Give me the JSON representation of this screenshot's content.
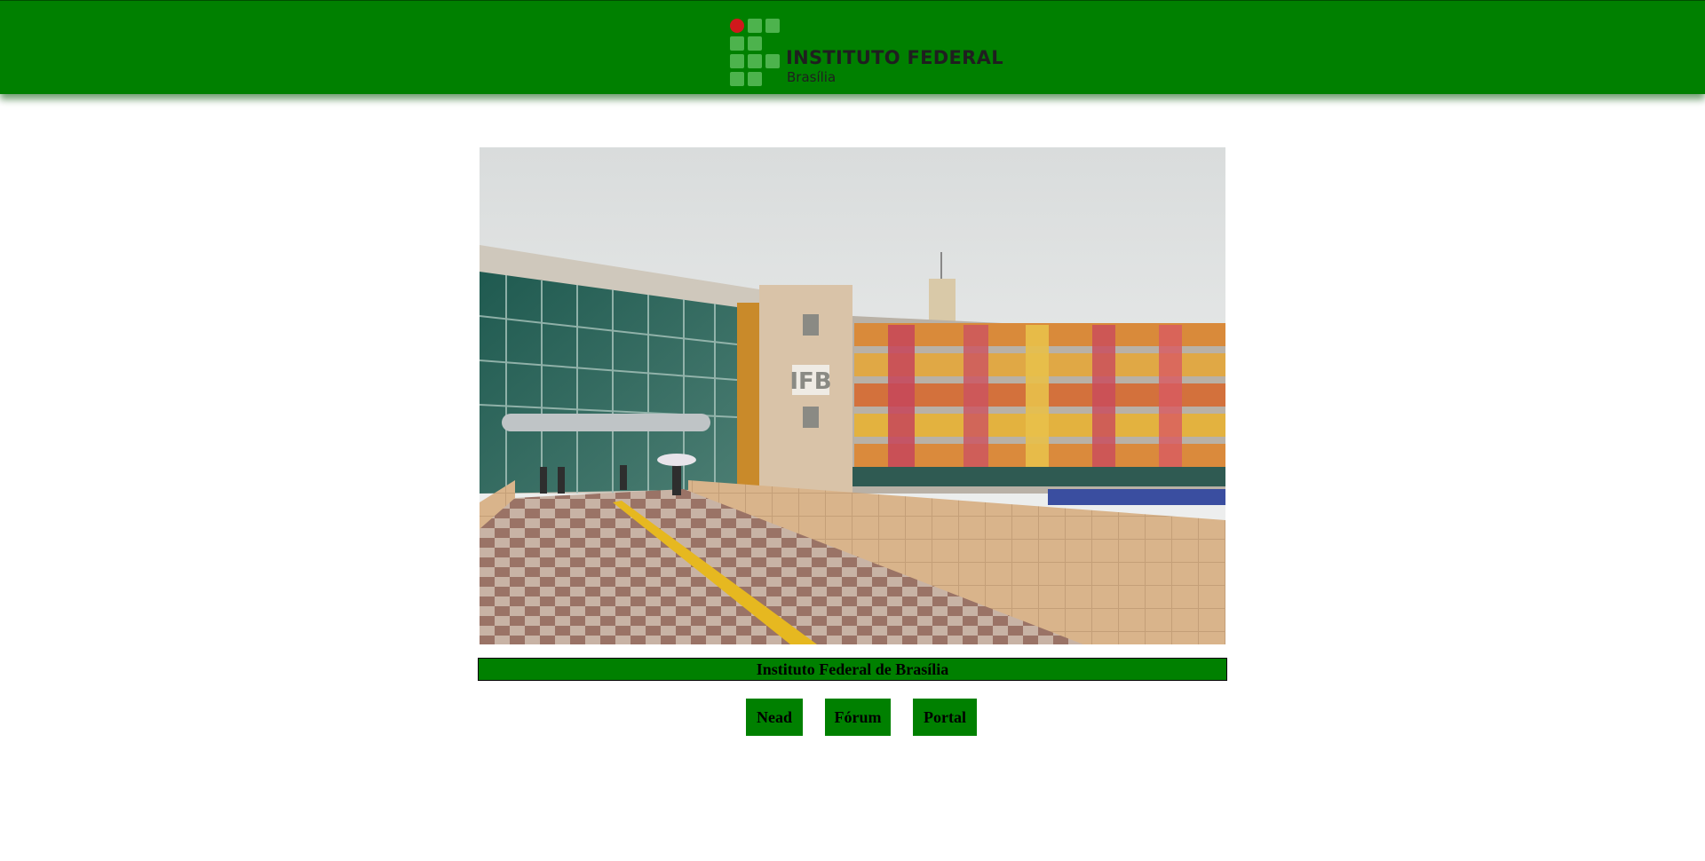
{
  "header": {
    "logo_title": "INSTITUTO FEDERAL",
    "logo_subtitle": "Brasília",
    "background_color": "#008000",
    "logo_dot_color": "#d0181c"
  },
  "main": {
    "photo_sign_text": "IFB",
    "caption": "Instituto Federal de Brasília"
  },
  "nav": {
    "nead_label": "Nead",
    "forum_label": "Fórum",
    "portal_label": "Portal"
  }
}
